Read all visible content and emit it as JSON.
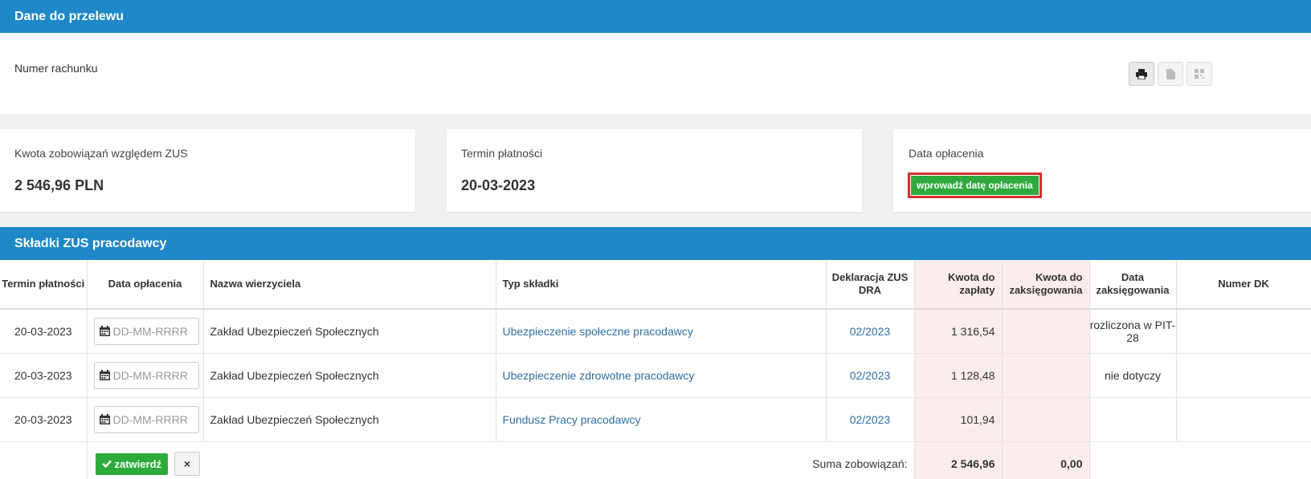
{
  "transfer": {
    "title": "Dane do przelewu",
    "account_label": "Numer rachunku"
  },
  "cards": {
    "amount_label": "Kwota zobowiązań względem ZUS",
    "amount_value": "2 546,96 PLN",
    "due_label": "Termin płatności",
    "due_value": "20-03-2023",
    "paid_label": "Data opłacenia",
    "paid_button": "wprowadź datę opłacenia"
  },
  "contributions": {
    "title": "Składki ZUS pracodawcy",
    "columns": [
      "Termin płatności",
      "Data opłacenia",
      "Nazwa wierzyciela",
      "Typ składki",
      "Deklaracja ZUS DRA",
      "Kwota do zapłaty",
      "Kwota do zaksięgowania",
      "Data zaksięgowania",
      "Numer DK"
    ],
    "date_placeholder": "DD-MM-RRRR",
    "rows": [
      {
        "due": "20-03-2023",
        "creditor": "Zakład Ubezpieczeń Społecznych",
        "type": "Ubezpieczenie społeczne pracodawcy",
        "declaration": "02/2023",
        "amount": "1 316,54",
        "to_book": "",
        "booked": "rozliczona w PIT-28",
        "dk": ""
      },
      {
        "due": "20-03-2023",
        "creditor": "Zakład Ubezpieczeń Społecznych",
        "type": "Ubezpieczenie zdrowotne pracodawcy",
        "declaration": "02/2023",
        "amount": "1 128,48",
        "to_book": "",
        "booked": "nie dotyczy",
        "dk": ""
      },
      {
        "due": "20-03-2023",
        "creditor": "Zakład Ubezpieczeń Społecznych",
        "type": "Fundusz Pracy pracodawcy",
        "declaration": "02/2023",
        "amount": "101,94",
        "to_book": "",
        "booked": "",
        "dk": ""
      }
    ],
    "confirm_label": "zatwierdź",
    "cancel_label": "×",
    "sum_label": "Suma zobowiązań:",
    "sum_amount": "2 546,96",
    "sum_to_book": "0,00"
  },
  "colors": {
    "header": "#1e88c8",
    "success": "#2eaa3c",
    "highlight": "#d32f2f",
    "pink_column": "#fbedec",
    "link": "#2f6fa3"
  },
  "icons": [
    "print-icon",
    "file-icon",
    "qr-code-icon",
    "calendar-icon",
    "check-icon"
  ]
}
